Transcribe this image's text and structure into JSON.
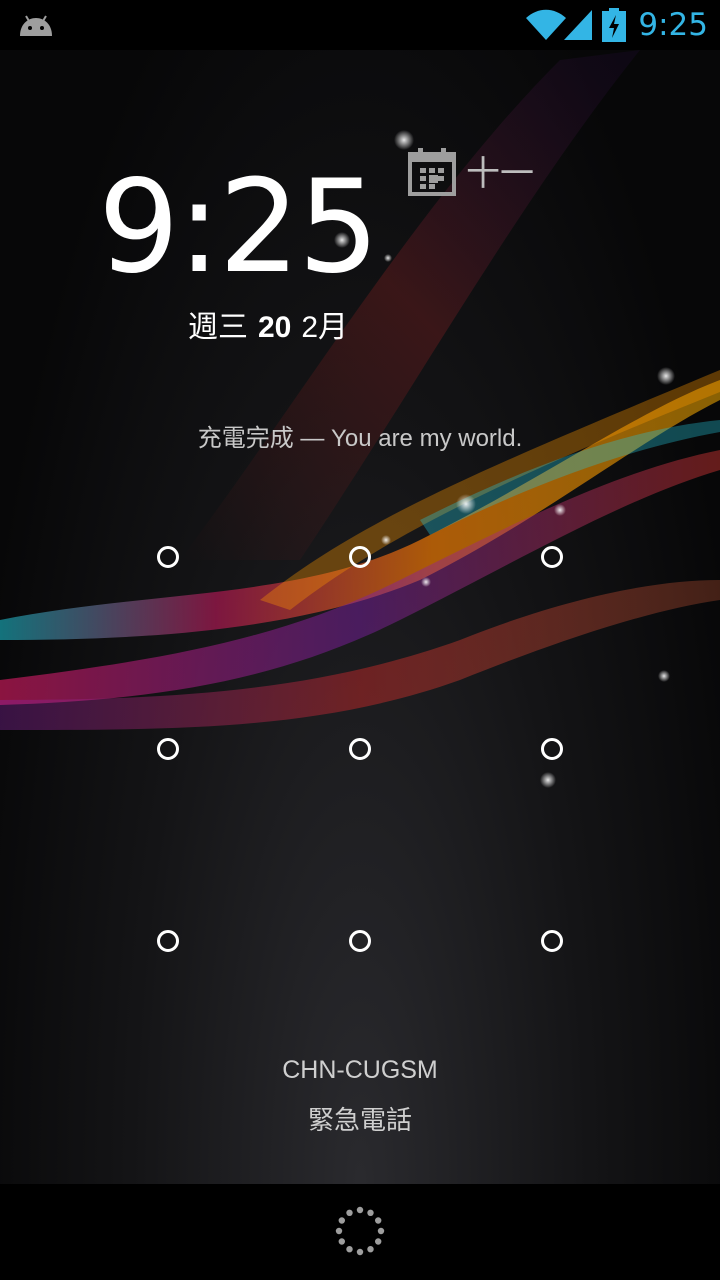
{
  "status_bar": {
    "time": "9:25",
    "icons": [
      "android-icon",
      "wifi-icon",
      "signal-icon",
      "battery-charging-icon"
    ],
    "accent_color": "#33b5e5"
  },
  "lockscreen": {
    "clock": {
      "hour": "9",
      "separator": ":",
      "minutes": "25"
    },
    "date": {
      "weekday": "週三",
      "day": "20",
      "month": "2月"
    },
    "alarm": {
      "icon": "calendar-icon",
      "text": "十一"
    },
    "status_message": "充電完成 — You are my world.",
    "carrier": "CHN-CUGSM",
    "emergency_call_label": "緊急電話"
  },
  "pattern_lock": {
    "rows": 3,
    "cols": 3,
    "dot_color": "#ffffff"
  },
  "nav_bar": {
    "icons": [
      "home-icon"
    ]
  }
}
